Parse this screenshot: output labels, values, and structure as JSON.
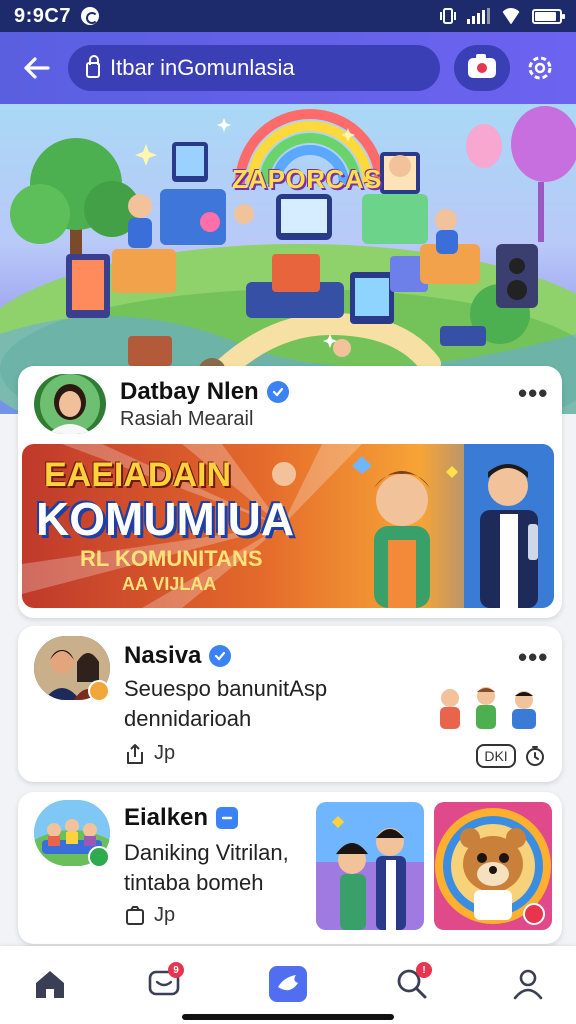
{
  "status_bar": {
    "time": "9:9C7"
  },
  "app_bar": {
    "back_icon": "arrow-left-icon",
    "search_text": "Itbar inGomunlasia",
    "camera_icon": "camera-icon",
    "settings_icon": "gear-icon"
  },
  "hero": {
    "title": "ZAPORCAS"
  },
  "posts": [
    {
      "author": "Datbay Nlen",
      "subtitle": "Rasiah Mearail",
      "banner": {
        "title_top": "EAEIADAIN",
        "title_main": "KOMUMIUA",
        "line1": "RL KOMUNITANS",
        "line2": "AA VIJLAA"
      }
    },
    {
      "author": "Nasiva",
      "text_line1": "Seuespo banunitAsp",
      "text_line2": "dennidarioah",
      "action_label": "Jp",
      "chip_label": "DKI"
    },
    {
      "author": "Eialken",
      "text_line1": "Daniking Vitrilan,",
      "text_line2": "tintaba bomeh",
      "action_label": "Jp"
    }
  ],
  "bottom_nav": {
    "items": [
      "home-icon",
      "chat-icon",
      "app-icon",
      "search-icon",
      "profile-icon"
    ],
    "badges": {
      "chat": "9",
      "search": "!"
    }
  },
  "colors": {
    "status_bar": "#1d2a6b",
    "app_bar": "#5a5fe0",
    "pill": "#3b3fb6",
    "verified": "#3b82f6",
    "accent_nav": "#4f6ef0"
  }
}
